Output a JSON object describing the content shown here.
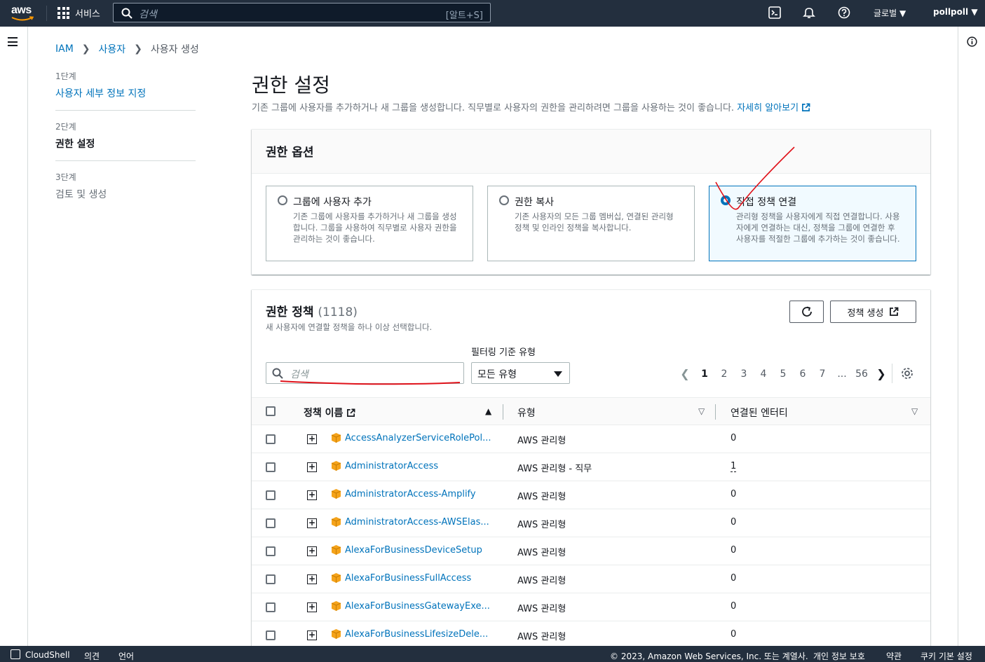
{
  "topnav": {
    "logo": "aws",
    "services_label": "서비스",
    "search_placeholder": "검색",
    "search_shortcut": "[알트+S]",
    "region": "글로벌",
    "account": "pollpoll"
  },
  "breadcrumb": {
    "items": [
      "IAM",
      "사용자",
      "사용자 생성"
    ]
  },
  "steps": [
    {
      "num": "1단계",
      "label": "사용자 세부 정보 지정"
    },
    {
      "num": "2단계",
      "label": "권한 설정"
    },
    {
      "num": "3단계",
      "label": "검토 및 생성"
    }
  ],
  "page": {
    "title": "권한 설정",
    "description": "기존 그룹에 사용자를 추가하거나 새 그룹을 생성합니다. 직무별로 사용자의 권한을 관리하려면 그룹을 사용하는 것이 좋습니다.",
    "learn_more": "자세히 알아보기"
  },
  "permission_options": {
    "header": "권한 옵션",
    "tiles": [
      {
        "title": "그룹에 사용자 추가",
        "description": "기존 그룹에 사용자를 추가하거나 새 그룹을 생성합니다. 그룹을 사용하여 직무별로 사용자 권한을 관리하는 것이 좋습니다.",
        "selected": false
      },
      {
        "title": "권한 복사",
        "description": "기존 사용자의 모든 그룹 멤버십, 연결된 관리형 정책 및 인라인 정책을 복사합니다.",
        "selected": false
      },
      {
        "title": "직접 정책 연결",
        "description": "관리형 정책을 사용자에게 직접 연결합니다. 사용자에게 연결하는 대신, 정책을 그룹에 연결한 후 사용자를 적절한 그룹에 추가하는 것이 좋습니다.",
        "selected": true
      }
    ]
  },
  "policies": {
    "title": "권한 정책",
    "count": "(1118)",
    "subtitle": "새 사용자에 연결할 정책을 하나 이상 선택합니다.",
    "create_button": "정책 생성",
    "filter_label": "필터링 기준 유형",
    "search_placeholder": "검색",
    "filter_value": "모든 유형",
    "pages": [
      "1",
      "2",
      "3",
      "4",
      "5",
      "6",
      "7",
      "...",
      "56"
    ],
    "columns": [
      "정책 이름",
      "유형",
      "연결된 엔터티"
    ],
    "rows": [
      {
        "name": "AccessAnalyzerServiceRolePol...",
        "type": "AWS 관리형",
        "entities": "0"
      },
      {
        "name": "AdministratorAccess",
        "type": "AWS 관리형 - 직무",
        "entities": "1"
      },
      {
        "name": "AdministratorAccess-Amplify",
        "type": "AWS 관리형",
        "entities": "0"
      },
      {
        "name": "AdministratorAccess-AWSElas...",
        "type": "AWS 관리형",
        "entities": "0"
      },
      {
        "name": "AlexaForBusinessDeviceSetup",
        "type": "AWS 관리형",
        "entities": "0"
      },
      {
        "name": "AlexaForBusinessFullAccess",
        "type": "AWS 관리형",
        "entities": "0"
      },
      {
        "name": "AlexaForBusinessGatewayExe...",
        "type": "AWS 관리형",
        "entities": "0"
      },
      {
        "name": "AlexaForBusinessLifesizeDele...",
        "type": "AWS 관리형",
        "entities": "0"
      }
    ]
  },
  "footer": {
    "cloudshell": "CloudShell",
    "feedback": "의견",
    "language": "언어",
    "copyright": "© 2023, Amazon Web Services, Inc. 또는 계열사.",
    "privacy": "개인 정보 보호",
    "terms": "약관",
    "cookies": "쿠키 기본 설정"
  },
  "colors": {
    "nav": "#232f3e",
    "link": "#0073bb",
    "annotation": "#e0121a",
    "cube": "#f5a31a"
  }
}
